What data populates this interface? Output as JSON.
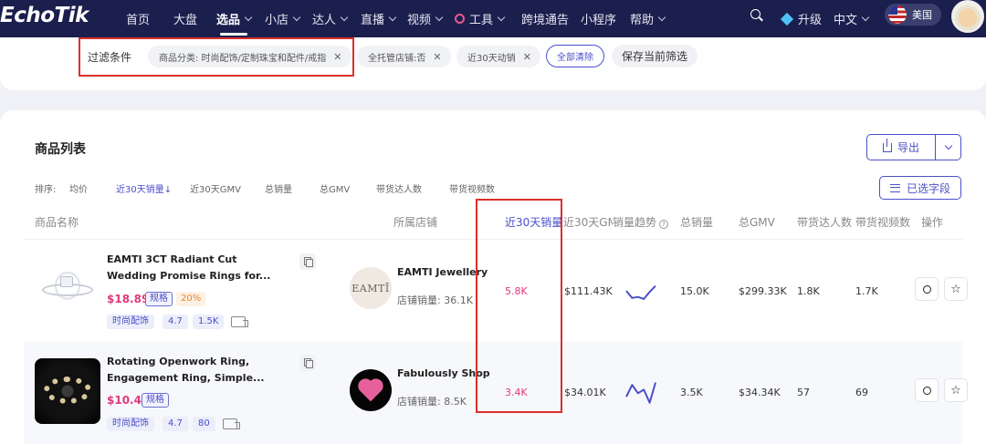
{
  "nav": {
    "logo": "EchoTik",
    "items": [
      {
        "label": "首页"
      },
      {
        "label": "大盘"
      },
      {
        "label": "选品"
      },
      {
        "label": "小店"
      },
      {
        "label": "达人"
      },
      {
        "label": "直播"
      },
      {
        "label": "视频"
      },
      {
        "label": "工具"
      },
      {
        "label": "跨境通告"
      },
      {
        "label": "小程序"
      },
      {
        "label": "帮助"
      }
    ],
    "upgrade": "升级",
    "language": "中文",
    "region": "美国"
  },
  "filters": {
    "label": "过滤条件",
    "chips": [
      {
        "text": "商品分类: 时尚配饰/定制珠宝和配件/戒指"
      },
      {
        "text": "全托管店铺:否"
      },
      {
        "text": "近30天动销"
      }
    ],
    "clear_all": "全部清除",
    "save": "保存当前筛选"
  },
  "panel": {
    "title": "商品列表",
    "export": "导出",
    "selected_fields": "已选字段",
    "sort_label": "排序:",
    "sort_options": [
      "均价",
      "近30天销量↓",
      "近30天GMV",
      "总销量",
      "总GMV",
      "带货达人数",
      "带货视频数"
    ],
    "columns": [
      "商品名称",
      "所属店铺",
      "近30天销量",
      "近30天GMV",
      "销量趋势",
      "总销量",
      "总GMV",
      "带货达人数",
      "带货视频数",
      "操作"
    ]
  },
  "rows": [
    {
      "name_line1": "EAMTI 3CT Radiant Cut",
      "name_line2": "Wedding Promise Rings for...",
      "price": "$18.89",
      "spec": "规格",
      "commission": "20%",
      "category": "时尚配饰",
      "rating": "4.7",
      "reviews": "1.5K",
      "shop_logo_text": "EAMTĪ",
      "shop_name": "EAMTI Jewellery",
      "shop_sales": "店铺销量: 36.1K",
      "sales_30d": "5.8K",
      "gmv_30d": "$111.43K",
      "trend": [
        0.55,
        0.9,
        0.85,
        0.95,
        0.6,
        0.3
      ],
      "total_sales": "15.0K",
      "total_gmv": "$299.33K",
      "creators": "1.8K",
      "videos": "1.7K"
    },
    {
      "name_line1": "Rotating Openwork Ring,",
      "name_line2": "Engagement Ring, Simple...",
      "price": "$10.49",
      "spec": "规格",
      "category": "时尚配饰",
      "rating": "4.7",
      "reviews": "80",
      "shop_logo_text": "",
      "shop_name": "Fabulously Shop",
      "shop_sales": "店铺销量: 8.5K",
      "sales_30d": "3.4K",
      "gmv_30d": "$34.01K",
      "trend": [
        0.7,
        0.2,
        0.55,
        0.4,
        0.95,
        0.1
      ],
      "total_sales": "3.5K",
      "total_gmv": "$34.34K",
      "creators": "57",
      "videos": "69"
    }
  ],
  "colors": {
    "nav_bg": "#1b1f4d",
    "accent": "#4b4fc9",
    "price": "#e0397c",
    "highlight_box": "#d9302c"
  }
}
